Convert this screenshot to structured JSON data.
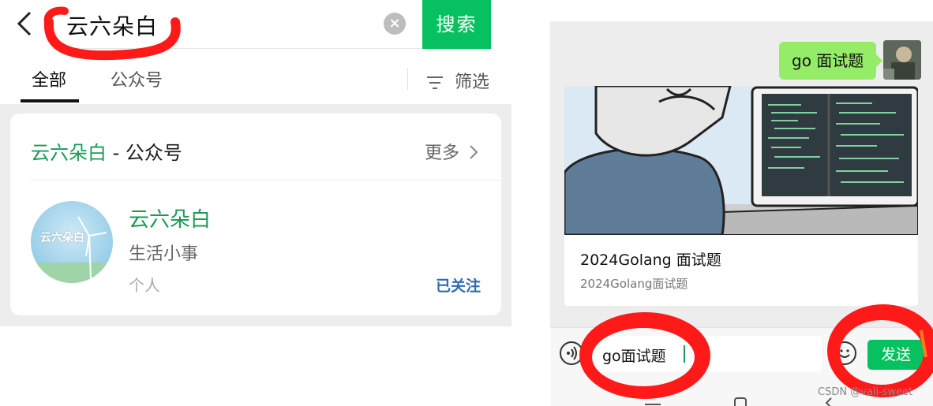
{
  "left": {
    "search": {
      "query": "云六朵白",
      "submit_label": "搜索"
    },
    "tabs": [
      {
        "label": "全部"
      },
      {
        "label": "公众号"
      }
    ],
    "filter_label": "筛选",
    "result_card": {
      "header_name": "云六朵白",
      "header_suffix": " - 公众号",
      "more_label": "更多",
      "account": {
        "name": "云六朵白",
        "avatar_text": "云六朵白",
        "description": "生活小事",
        "type": "个人",
        "follow_status": "已关注"
      }
    }
  },
  "chat": {
    "sent_message": "go 面试题",
    "link_card": {
      "title": "2024Golang 面试题",
      "subtitle": "2024Golang面试题"
    },
    "input_value": "go面试题",
    "send_label": "发送"
  },
  "watermark": "CSDN @vali-sweet",
  "colors": {
    "wechat_green": "#07c160",
    "bubble_green": "#95ec69",
    "account_green": "#1b9a55",
    "follow_blue": "#2f6bb5",
    "annotation_red": "#ff1a1a"
  }
}
